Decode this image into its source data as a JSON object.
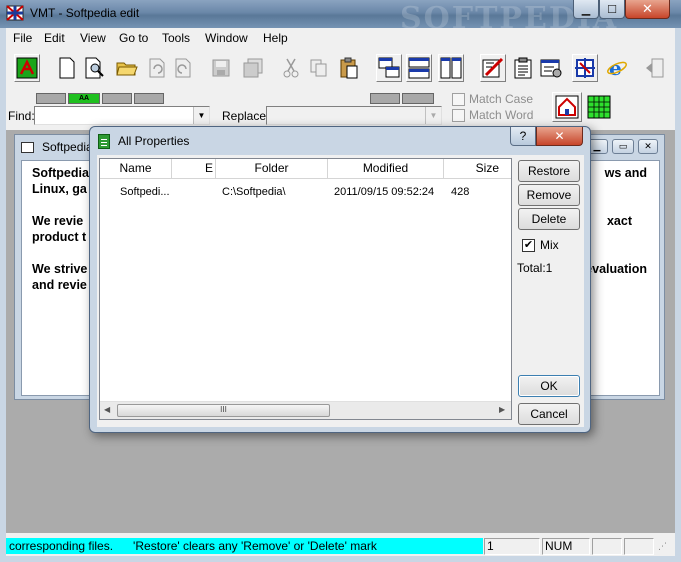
{
  "window": {
    "title": "VMT - Softpedia edit",
    "watermark": "SOFTPEDIA"
  },
  "menu": [
    "File",
    "Edit",
    "View",
    "Go to",
    "Tools",
    "Window",
    "Help"
  ],
  "toolbar": {
    "buttons": [
      "app-logo-icon",
      "new-document-icon",
      "find-document-icon",
      "open-folder-icon",
      "undo-icon",
      "redo-icon",
      "save-icon",
      "save-all-icon",
      "cut-icon",
      "copy-icon",
      "paste-icon",
      "cascade-windows-icon",
      "tile-horizontal-icon",
      "tile-vertical-icon",
      "properties-icon",
      "document-list-icon",
      "settings-icon",
      "sync-icon",
      "internet-explorer-icon",
      "exit-icon"
    ]
  },
  "findbar": {
    "find_label": "Find:",
    "replace_label": "Replace:",
    "find_value": "",
    "replace_value": "",
    "match_case": "Match Case",
    "match_word": "Match Word",
    "mini_buttons": [
      "",
      "AA",
      "",
      "",
      ""
    ]
  },
  "document": {
    "title": "Softpedia",
    "lines_left": [
      "Softpedia",
      "Linux, ga",
      "We revie",
      "product t",
      "We strive",
      "and revie"
    ],
    "lines_right": [
      "ws and",
      "xact",
      "evaluation"
    ]
  },
  "dialog": {
    "title": "All Properties",
    "help": "?",
    "close": "✕",
    "columns": [
      "Name",
      "E",
      "Folder",
      "Modified",
      "Size"
    ],
    "rows": [
      {
        "name": "Softpedi...",
        "ext": "",
        "folder": "C:\\Softpedia\\",
        "modified": "2011/09/15 09:52:24",
        "size": "428"
      }
    ],
    "scroll_thumb": "III",
    "buttons": {
      "restore": "Restore",
      "remove": "Remove",
      "delete": "Delete",
      "ok": "OK",
      "cancel": "Cancel"
    },
    "mix_label": "Mix",
    "mix_checked": true,
    "total": "Total:1"
  },
  "statusbar": {
    "message": "corresponding files.      'Restore' clears any 'Remove' or 'Delete' mark",
    "line": "1",
    "col": "",
    "num": "NUM",
    "extra1": "",
    "extra2": ""
  }
}
